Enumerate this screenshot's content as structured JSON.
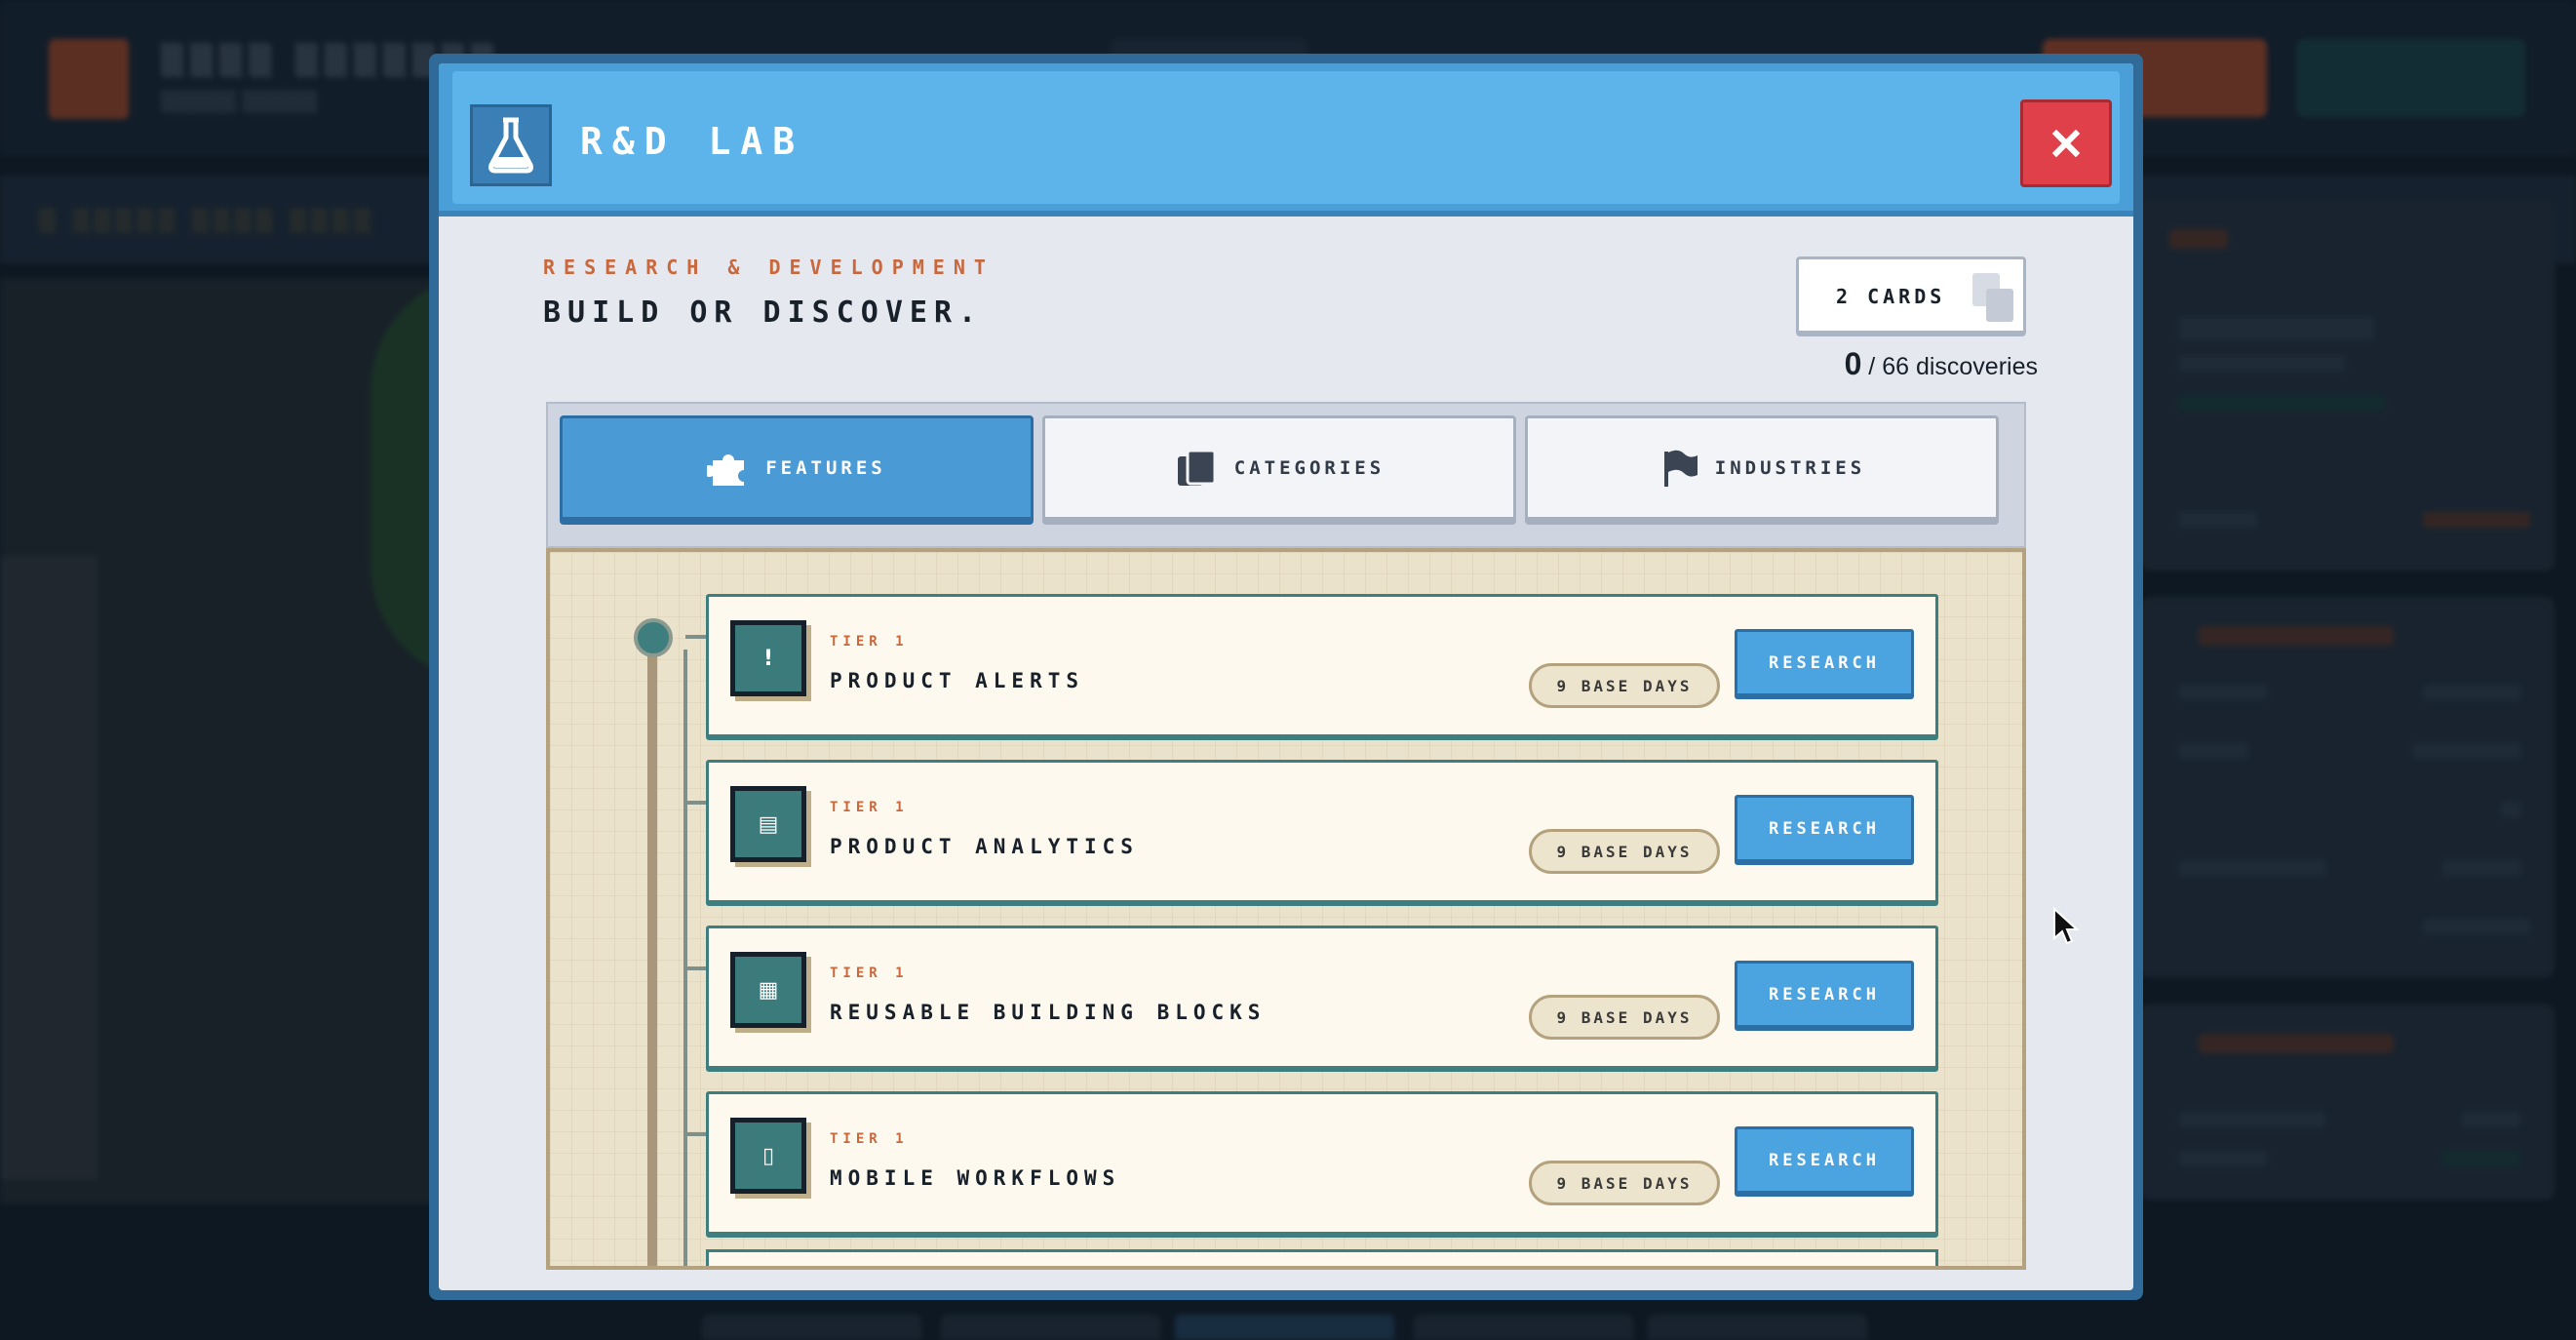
{
  "modal": {
    "title": "R&D LAB",
    "eyebrow": "RESEARCH & DEVELOPMENT",
    "headline": "BUILD OR DISCOVER.",
    "cards_label": "2 CARDS",
    "discoveries_count": "0",
    "discoveries_suffix": " / 66 discoveries",
    "close_icon": "close-icon",
    "header_icon": "flask-icon"
  },
  "tabs": [
    {
      "label": "FEATURES",
      "icon": "puzzle-icon",
      "active": true
    },
    {
      "label": "CATEGORIES",
      "icon": "cards-icon",
      "active": false
    },
    {
      "label": "INDUSTRIES",
      "icon": "flag-icon",
      "active": false
    }
  ],
  "research_items": [
    {
      "tier": "TIER 1",
      "name": "PRODUCT ALERTS",
      "days": "9 BASE DAYS",
      "action": "RESEARCH",
      "glyph": "!"
    },
    {
      "tier": "TIER 1",
      "name": "PRODUCT ANALYTICS",
      "days": "9 BASE DAYS",
      "action": "RESEARCH",
      "glyph": "▤"
    },
    {
      "tier": "TIER 1",
      "name": "REUSABLE BUILDING BLOCKS",
      "days": "9 BASE DAYS",
      "action": "RESEARCH",
      "glyph": "▦"
    },
    {
      "tier": "TIER 1",
      "name": "MOBILE WORKFLOWS",
      "days": "9 BASE DAYS",
      "action": "RESEARCH",
      "glyph": "▯"
    }
  ],
  "colors": {
    "header_blue": "#5cb4ea",
    "accent_orange": "#c8683c",
    "teal": "#3c7b7c",
    "close_red": "#e0404a"
  }
}
